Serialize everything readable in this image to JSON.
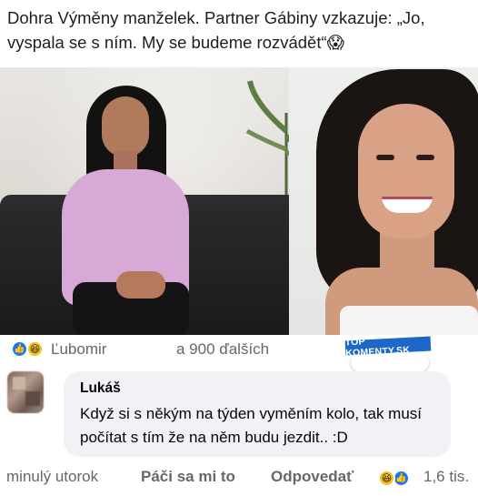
{
  "post": {
    "text": "Dohra Výměny manželek. Partner Gábiny vzkazuje: „Jo, vyspala se s ním. My se budeme rozvádět“😱"
  },
  "media": {
    "icon": "video-thumbnail-two-women"
  },
  "reactions": {
    "icons": [
      "like-icon",
      "haha-icon"
    ],
    "name": "Ľubomir",
    "others": "a 900 ďalších"
  },
  "badge": {
    "label": "TOP KOMENTY.SK",
    "color": "#1c67c8"
  },
  "comment": {
    "author": "Lukáš",
    "text": "Když si s někým na týden vyměním kolo, tak musí počítat s tím že na něm budu jezdit.. :D",
    "timestamp": "minulý utorok",
    "like_label": "Páči sa mi to",
    "reply_label": "Odpovedať",
    "reaction_count": "1,6 tis."
  },
  "colors": {
    "like_blue": "#1877f2",
    "haha_yellow": "#f7c01b",
    "secondary_text": "#65676b",
    "bubble_bg": "#f0f2f5"
  }
}
